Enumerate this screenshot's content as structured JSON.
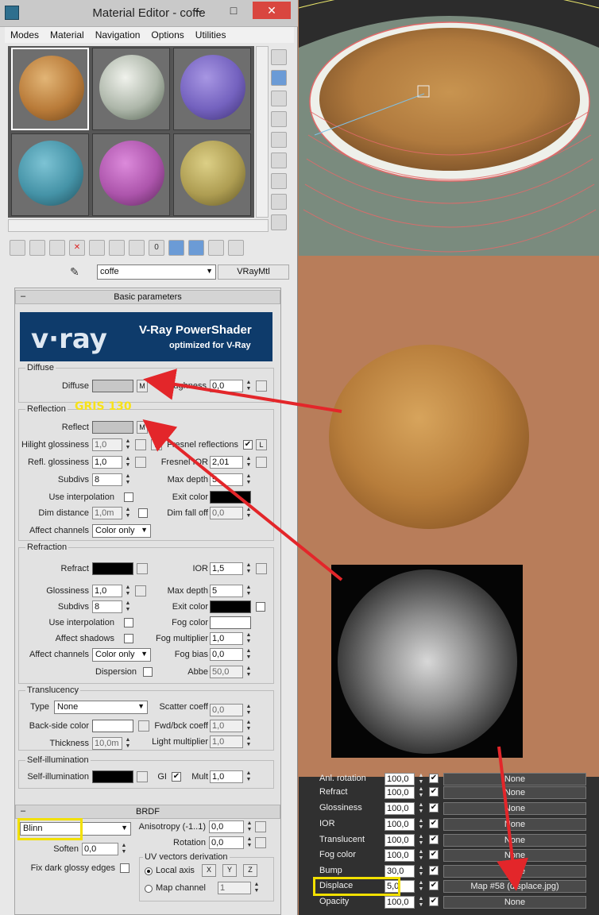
{
  "window": {
    "title": "Material Editor - coffe",
    "minimize": "–",
    "maximize": "□",
    "close": "✕"
  },
  "menus": [
    "Modes",
    "Material",
    "Navigation",
    "Options",
    "Utilities"
  ],
  "slots": [
    {
      "name": "coffee-foam",
      "color": "#c48a46"
    },
    {
      "name": "marble-green",
      "color": "#c7c9c2"
    },
    {
      "name": "purple",
      "color": "#7f6dc4"
    },
    {
      "name": "cyan",
      "color": "#4d99ad"
    },
    {
      "name": "magenta",
      "color": "#b65cb6"
    },
    {
      "name": "khaki",
      "color": "#b7a658"
    }
  ],
  "material": {
    "name": "coffe",
    "type": "VRayMtl"
  },
  "rollout_basic": "Basic parameters",
  "banner": {
    "logo": "v·ray",
    "line1": "V-Ray PowerShader",
    "line2": "optimized for V-Ray"
  },
  "diffuse": {
    "group": "Diffuse",
    "label": "Diffuse",
    "m": "M",
    "roughness_label": "Roughness",
    "roughness": "0,0"
  },
  "reflection": {
    "group": "Reflection",
    "reflect_label": "Reflect",
    "m": "M",
    "hilight_label": "Hilight glossiness",
    "hilight": "1,0",
    "l": "L",
    "fresnel_label": "Fresnel reflections",
    "fresnel_l": "L",
    "refl_gloss_label": "Refl. glossiness",
    "refl_gloss": "1,0",
    "fresnel_ior_label": "Fresnel IOR",
    "fresnel_ior": "2,01",
    "subdivs_label": "Subdivs",
    "subdivs": "8",
    "max_depth_label": "Max depth",
    "max_depth": "5",
    "use_interp_label": "Use interpolation",
    "exit_color_label": "Exit color",
    "dim_distance_label": "Dim distance",
    "dim_distance": "1,0m",
    "dim_falloff_label": "Dim fall off",
    "dim_falloff": "0,0",
    "affect_channels_label": "Affect channels",
    "affect_channels": "Color only"
  },
  "annotation_gris": "GRIS 130",
  "refraction": {
    "group": "Refraction",
    "refract_label": "Refract",
    "ior_label": "IOR",
    "ior": "1,5",
    "glossiness_label": "Glossiness",
    "glossiness": "1,0",
    "max_depth_label": "Max depth",
    "max_depth": "5",
    "subdivs_label": "Subdivs",
    "subdivs": "8",
    "exit_color_label": "Exit color",
    "use_interp_label": "Use interpolation",
    "fog_color_label": "Fog color",
    "affect_shadows_label": "Affect shadows",
    "fog_mult_label": "Fog multiplier",
    "fog_mult": "1,0",
    "affect_channels_label": "Affect channels",
    "affect_channels": "Color only",
    "fog_bias_label": "Fog bias",
    "fog_bias": "0,0",
    "dispersion_label": "Dispersion",
    "abbe_label": "Abbe",
    "abbe": "50,0"
  },
  "translucency": {
    "group": "Translucency",
    "type_label": "Type",
    "type": "None",
    "scatter_label": "Scatter coeff",
    "scatter": "0,0",
    "backside_label": "Back-side color",
    "fwdbck_label": "Fwd/bck coeff",
    "fwdbck": "1,0",
    "thickness_label": "Thickness",
    "thickness": "10,0m",
    "light_mult_label": "Light multiplier",
    "light_mult": "1,0"
  },
  "selfillum": {
    "group": "Self-illumination",
    "label": "Self-illumination",
    "gi_label": "GI",
    "mult_label": "Mult",
    "mult": "1,0"
  },
  "brdf": {
    "header": "BRDF",
    "type": "Blinn",
    "anisotropy_label": "Anisotropy (-1..1)",
    "anisotropy": "0,0",
    "rotation_label": "Rotation",
    "rotation": "0,0",
    "soften_label": "Soften",
    "soften": "0,0",
    "uv_group": "UV vectors derivation",
    "fix_dark_label": "Fix dark glossy edges",
    "local_axis_label": "Local axis",
    "x": "X",
    "y": "Y",
    "z": "Z",
    "map_channel_label": "Map channel",
    "map_channel": "1"
  },
  "maps": [
    {
      "label": "Anl. rotation",
      "amount": "100,0",
      "map": "None"
    },
    {
      "label": "Refract",
      "amount": "100,0",
      "map": "None"
    },
    {
      "label": "Glossiness",
      "amount": "100,0",
      "map": "None"
    },
    {
      "label": "IOR",
      "amount": "100,0",
      "map": "None"
    },
    {
      "label": "Translucent",
      "amount": "100,0",
      "map": "None"
    },
    {
      "label": "Fog color",
      "amount": "100,0",
      "map": "None"
    },
    {
      "label": "Bump",
      "amount": "30,0",
      "map": "None"
    },
    {
      "label": "Displace",
      "amount": "5,0",
      "map": "Map #58 (displace.jpg)"
    },
    {
      "label": "Opacity",
      "amount": "100,0",
      "map": "None"
    }
  ],
  "colors": {
    "highlight": "#f2e000",
    "arrow": "#e3262a",
    "accent": "#6b9bd6"
  }
}
